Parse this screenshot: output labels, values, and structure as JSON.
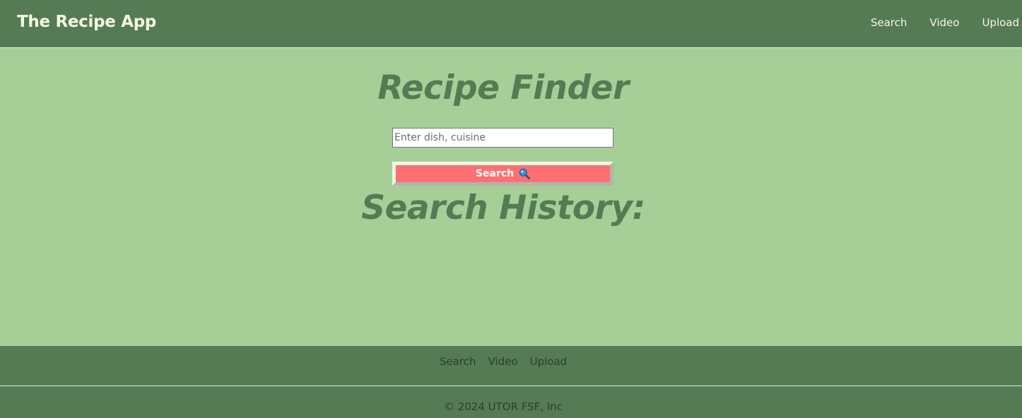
{
  "header": {
    "brand": "The Recipe App",
    "nav": [
      "Search",
      "Video",
      "Upload"
    ]
  },
  "main": {
    "title": "Recipe Finder",
    "search_placeholder": "Enter dish, cuisine",
    "search_button_label": "Search",
    "history_title": "Search History:"
  },
  "footer": {
    "nav": [
      "Search",
      "Video",
      "Upload"
    ],
    "copyright": "© 2024 UTOR FSF, Inc"
  },
  "colors": {
    "header_bg": "#557b54",
    "page_bg": "#a5cf97",
    "button_bg": "#fc7071",
    "title_color": "#557b54"
  },
  "icons": {
    "search_button_icon": "magnifying-glass-icon"
  }
}
